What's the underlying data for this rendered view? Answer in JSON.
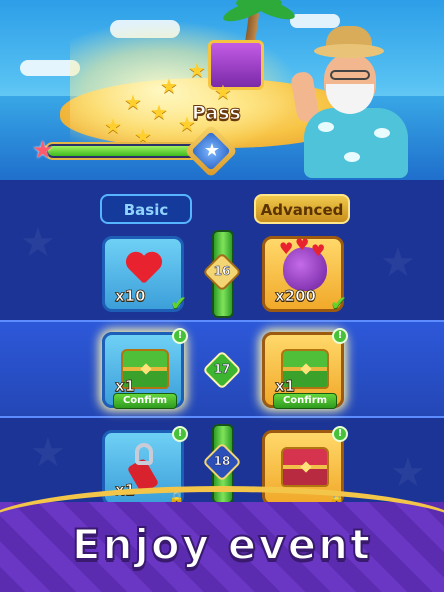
{
  "header": {
    "pass_label": "Pass",
    "progress": {
      "fraction": 0.82
    }
  },
  "tabs": {
    "basic_label": "Basic",
    "advanced_label": "Advanced"
  },
  "rows": [
    {
      "level": "16",
      "basic": {
        "item": "heart-icon",
        "qty": "x10",
        "claimed": true
      },
      "advanced": {
        "item": "heart-bag-icon",
        "qty": "x200",
        "claimed": true
      }
    },
    {
      "level": "17",
      "basic": {
        "item": "green-chest-icon",
        "qty": "x1",
        "confirm_label": "Confirm"
      },
      "advanced": {
        "item": "green-chest-icon",
        "qty": "x1",
        "confirm_label": "Confirm"
      }
    },
    {
      "level": "18",
      "basic": {
        "item": "zipper-icon",
        "qty": "x1",
        "locked": true
      },
      "advanced": {
        "item": "red-chest-icon",
        "qty": "",
        "locked": true
      }
    }
  ],
  "footer": {
    "banner_text": "Enjoy event"
  },
  "colors": {
    "accent_gold": "#f3c64a",
    "row_highlight": "#2d58d9",
    "confirm_green": "#3eb531",
    "footer_purple": "#5b2cb0"
  }
}
